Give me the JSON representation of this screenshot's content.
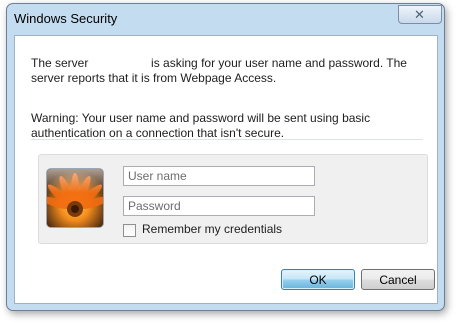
{
  "window": {
    "title": "Windows Security",
    "close_glyph": "✕"
  },
  "message": {
    "line1_prefix": "The server",
    "line1_suffix": "is asking for your user name and password. The server reports that it is from Webpage Access.",
    "warning": "Warning: Your user name and password will be sent using basic authentication on a connection that isn't secure."
  },
  "credentials": {
    "username_placeholder": "User name",
    "username_value": "",
    "password_placeholder": "Password",
    "password_value": "",
    "remember_label": "Remember my credentials",
    "remember_checked": false,
    "user_tile_icon": "flower-user-tile-icon"
  },
  "buttons": {
    "ok": "OK",
    "cancel": "Cancel"
  },
  "colors": {
    "frame": "#c3dcf0",
    "ok_button": "#98d1ef",
    "panel": "#f0f0f0"
  }
}
